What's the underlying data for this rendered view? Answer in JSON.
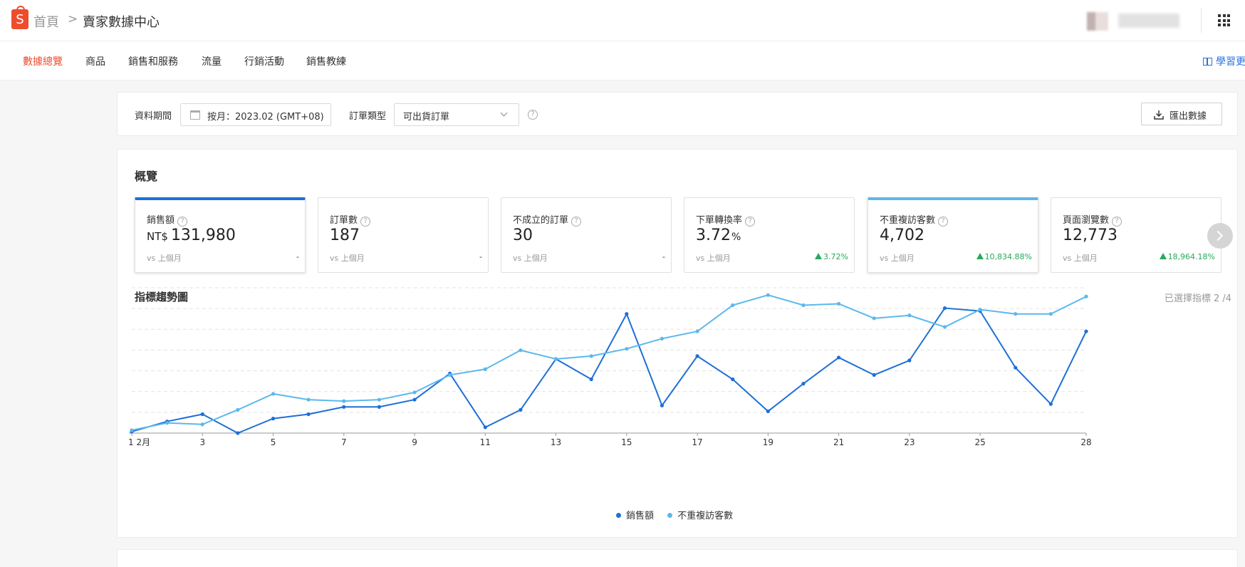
{
  "breadcrumb": {
    "logo": "S",
    "home": "首頁",
    "separator": ">",
    "current": "賣家數據中心"
  },
  "nav": {
    "tabs": [
      "數據總覽",
      "商品",
      "銷售和服務",
      "流量",
      "行銷活動",
      "銷售教練"
    ],
    "active_index": 0,
    "learn_more": "學習更"
  },
  "filters": {
    "period_label": "資料期間",
    "period_value": "按月：2023.02 (GMT+08)",
    "order_type_label": "訂單類型",
    "order_type_value": "可出貨訂單",
    "help_glyph": "?",
    "export_label": "匯出數據"
  },
  "overview": {
    "title": "概覽",
    "metrics": [
      {
        "label": "銷售額",
        "prefix": "NT$",
        "value": "131,980",
        "suffix": "",
        "vs": "vs 上個月",
        "change": "-",
        "trend": "none",
        "selected": "dark"
      },
      {
        "label": "訂單數",
        "prefix": "",
        "value": "187",
        "suffix": "",
        "vs": "vs 上個月",
        "change": "-",
        "trend": "none",
        "selected": ""
      },
      {
        "label": "不成立的訂單",
        "prefix": "",
        "value": "30",
        "suffix": "",
        "vs": "vs 上個月",
        "change": "-",
        "trend": "none",
        "selected": ""
      },
      {
        "label": "下單轉換率",
        "prefix": "",
        "value": "3.72",
        "suffix": "%",
        "vs": "vs 上個月",
        "change": "3.72%",
        "trend": "up",
        "selected": ""
      },
      {
        "label": "不重複訪客數",
        "prefix": "",
        "value": "4,702",
        "suffix": "",
        "vs": "vs 上個月",
        "change": "10,834.88%",
        "trend": "up",
        "selected": "light"
      },
      {
        "label": "頁面瀏覽數",
        "prefix": "",
        "value": "12,773",
        "suffix": "",
        "vs": "vs 上個月",
        "change": "18,964.18%",
        "trend": "up",
        "selected": ""
      }
    ]
  },
  "trend": {
    "title": "指標趨勢圖",
    "selected_count": "已選擇指標 2 /4"
  },
  "chart_data": {
    "type": "line",
    "title": "指標趨勢圖",
    "x": [
      1,
      2,
      3,
      4,
      5,
      6,
      7,
      8,
      9,
      10,
      11,
      12,
      13,
      14,
      15,
      16,
      17,
      18,
      19,
      20,
      21,
      22,
      23,
      24,
      25,
      26,
      27,
      28
    ],
    "x_tick_labels": [
      "1 2月",
      "3",
      "5",
      "7",
      "9",
      "11",
      "13",
      "15",
      "17",
      "19",
      "21",
      "23",
      "25",
      "28"
    ],
    "x_tick_positions": [
      1,
      3,
      5,
      7,
      9,
      11,
      13,
      15,
      17,
      19,
      21,
      23,
      25,
      28
    ],
    "ylim": [
      0,
      100
    ],
    "grid": true,
    "legend_position": "bottom-center",
    "series": [
      {
        "name": "銷售額",
        "color": "#1d6fd8",
        "values": [
          1,
          8,
          13,
          0,
          10,
          13,
          18,
          18,
          23,
          41,
          4,
          16,
          51,
          37,
          82,
          19,
          53,
          37,
          15,
          34,
          52,
          40,
          50,
          86,
          84,
          45,
          20,
          70
        ]
      },
      {
        "name": "不重複訪客數",
        "color": "#5cb8ec",
        "values": [
          2,
          7,
          6,
          16,
          27,
          23,
          22,
          23,
          28,
          40,
          44,
          57,
          51,
          53,
          58,
          65,
          70,
          88,
          95,
          88,
          89,
          79,
          81,
          73,
          85,
          82,
          82,
          94
        ]
      }
    ]
  }
}
